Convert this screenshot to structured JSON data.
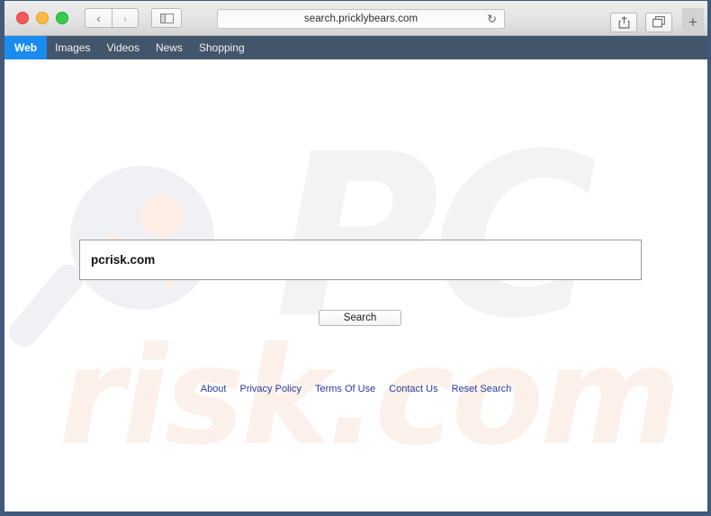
{
  "browser": {
    "url": "search.pricklybears.com",
    "traffic_lights": [
      "close",
      "minimize",
      "maximize"
    ],
    "back_label": "‹",
    "forward_label": "›",
    "reload_label": "↻",
    "new_tab_label": "+"
  },
  "site_nav": {
    "items": [
      {
        "label": "Web",
        "active": true
      },
      {
        "label": "Images",
        "active": false
      },
      {
        "label": "Videos",
        "active": false
      },
      {
        "label": "News",
        "active": false
      },
      {
        "label": "Shopping",
        "active": false
      }
    ]
  },
  "search": {
    "value": "pcrisk.com",
    "placeholder": "",
    "button_label": "Search"
  },
  "footer": {
    "links": [
      "About",
      "Privacy Policy",
      "Terms Of Use",
      "Contact Us",
      "Reset Search"
    ]
  },
  "watermarks": {
    "pc_text": "PC",
    "risk_text": "risk.com"
  },
  "colors": {
    "nav_bar": "#42556a",
    "active_tab": "#1a8cf0",
    "link": "#2a3b9c",
    "window_border": "#41597a",
    "watermark_gray": "#f3f3f3",
    "watermark_peach": "#fbf1ea"
  }
}
